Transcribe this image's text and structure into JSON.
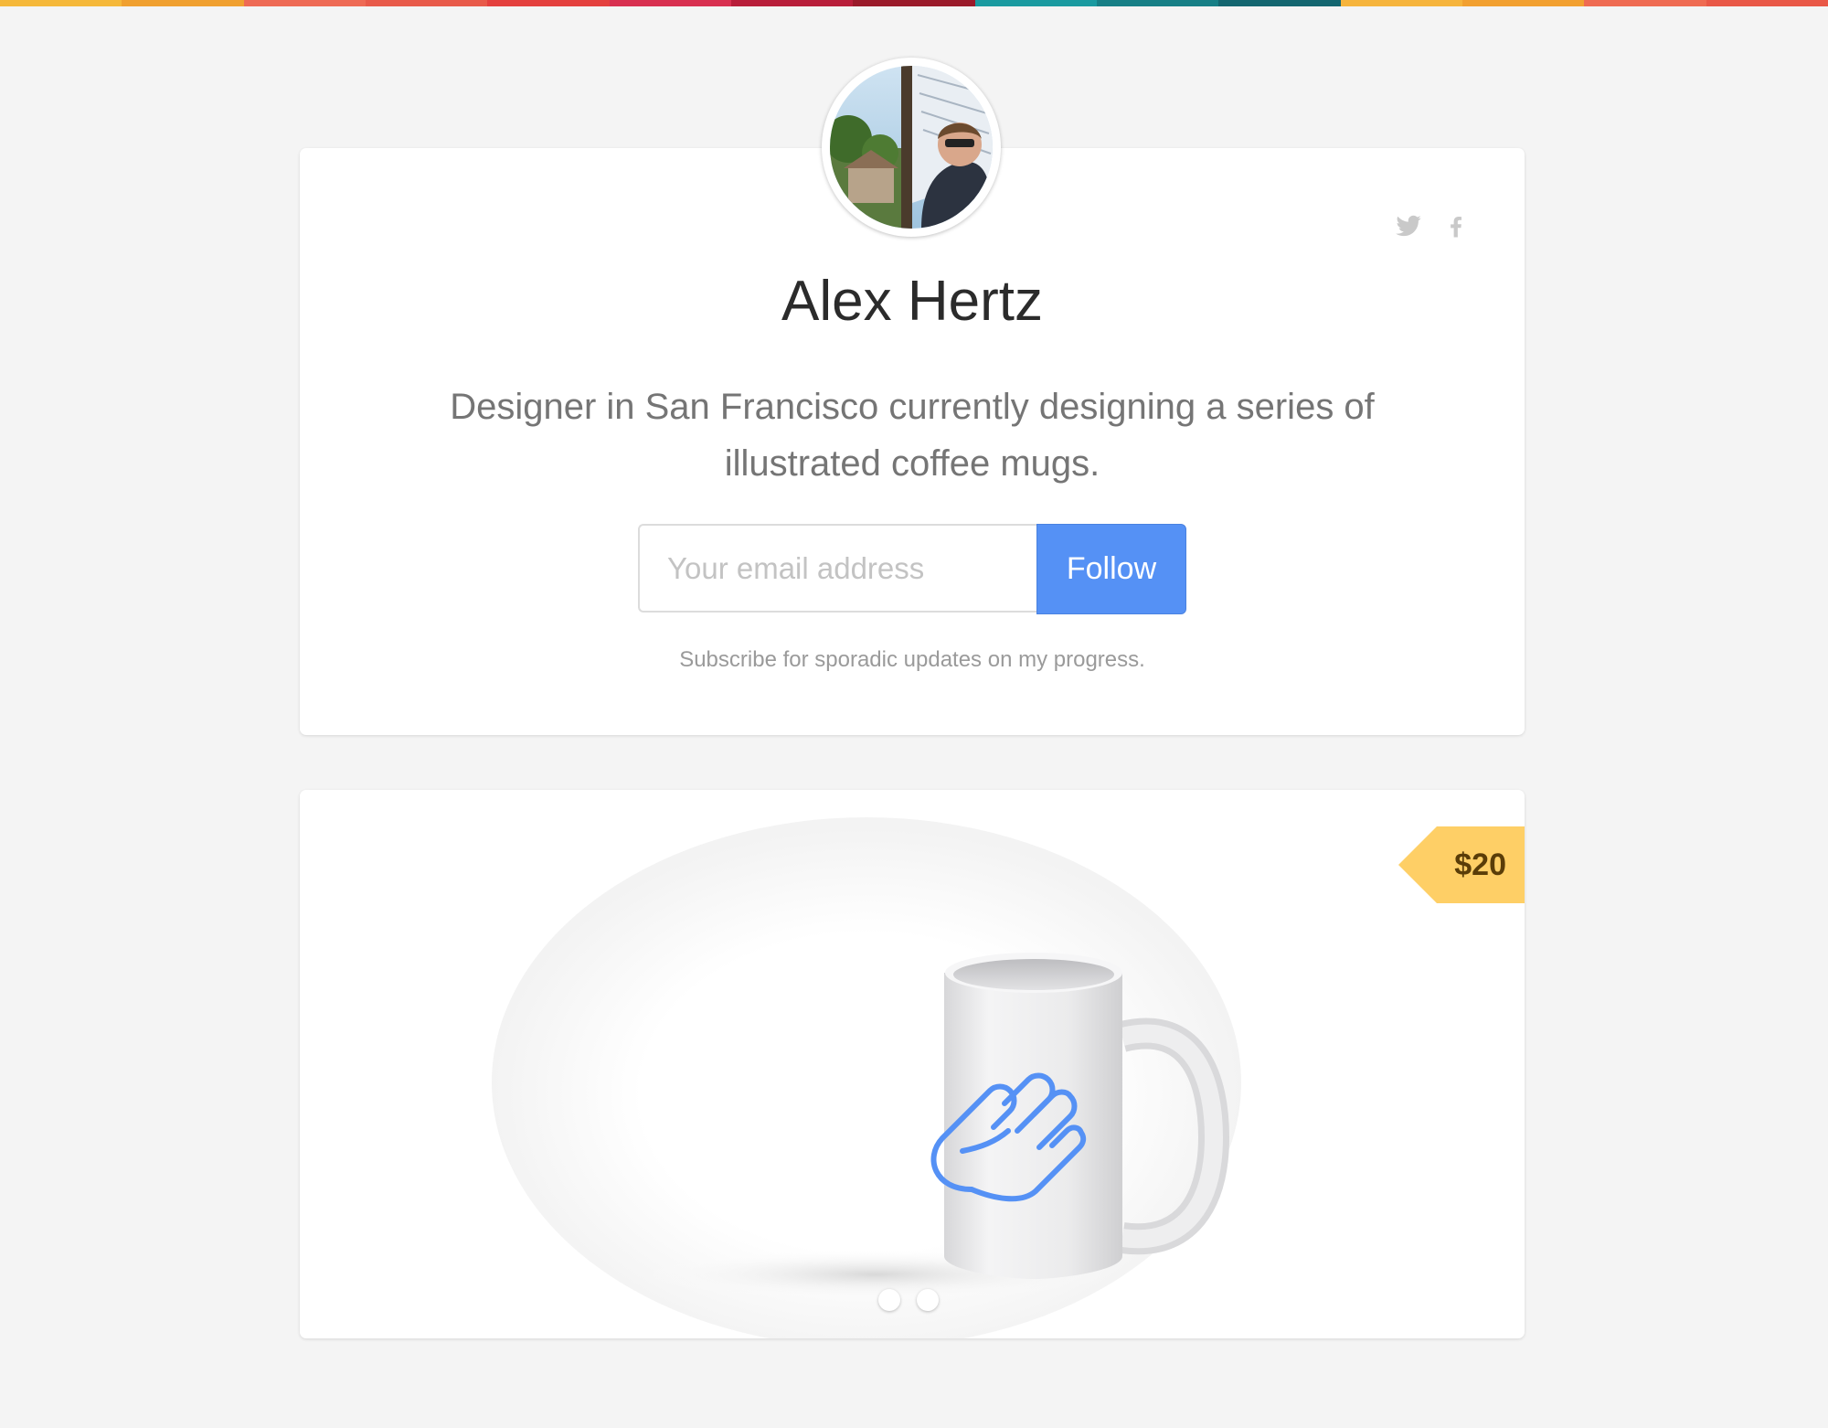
{
  "topbar": {
    "colors": [
      "#f5b83a",
      "#f0a030",
      "#ee6a55",
      "#e85a4a",
      "#e4403e",
      "#d83050",
      "#b81e3a",
      "#9a1a2a",
      "#1a9aa0",
      "#177f86",
      "#146670",
      "#f6b43c",
      "#f2a030",
      "#ef6b52",
      "#e95847"
    ]
  },
  "profile": {
    "name": "Alex Hertz",
    "bio": "Designer in San Francisco currently designing a series of illustrated coffee mugs.",
    "email_placeholder": "Your email address",
    "follow_label": "Follow",
    "note": "Subscribe for sporadic updates on my progress.",
    "social": [
      "twitter-icon",
      "facebook-icon"
    ]
  },
  "product": {
    "price": "$20",
    "carousel_pages": 2,
    "accent_color": "#5591f5"
  }
}
